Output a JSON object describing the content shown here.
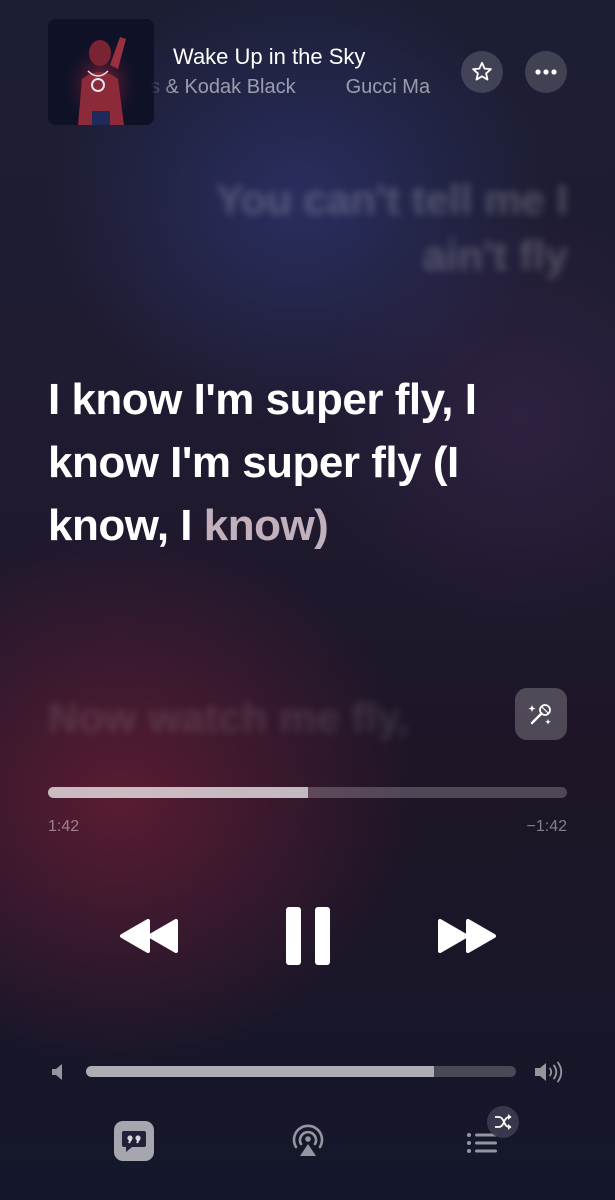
{
  "now_playing": {
    "title": "Wake Up in the Sky",
    "artists_scroll": "s & Kodak Black",
    "artists_scroll_next": "Gucci Ma"
  },
  "lyrics": {
    "previous": "You can't tell me I ain't fly",
    "current_main": "I know I'm super fly, I know I'm super fly (I know, I ",
    "current_tail": "know)",
    "next": "Now watch me fly,"
  },
  "playback": {
    "elapsed": "1:42",
    "remaining": "−1:42",
    "progress": 0.5,
    "volume": 0.81
  },
  "icons": {
    "favorite": "star-icon",
    "more": "ellipsis-icon",
    "sing": "microphone-sparkle-icon",
    "rewind": "rewind-icon",
    "pause": "pause-icon",
    "forward": "fast-forward-icon",
    "volume_low": "speaker-low-icon",
    "volume_high": "speaker-high-icon",
    "lyrics": "lyrics-quote-icon",
    "airplay": "airplay-audio-icon",
    "queue": "queue-list-icon",
    "shuffle": "shuffle-icon"
  },
  "colors": {
    "accent_text": "#ffffff",
    "lyric_tail": "#f0dce6"
  }
}
